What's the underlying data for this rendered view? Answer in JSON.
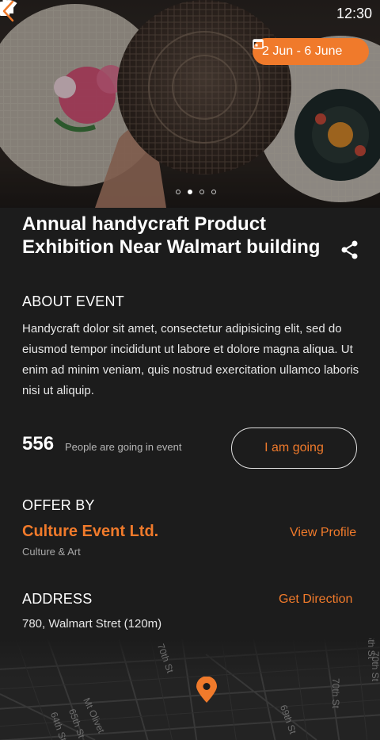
{
  "status_bar": {
    "time": "12:30",
    "icons": [
      "wifi-icon",
      "signal-icon",
      "battery-icon"
    ]
  },
  "hero": {
    "date_range": "2 Jun - 6 June",
    "carousel": {
      "total": 4,
      "active_index": 1
    }
  },
  "event": {
    "title": "Annual handycraft Product Exhibition Near Walmart building"
  },
  "about": {
    "heading": "ABOUT EVENT",
    "text": "Handycraft dolor sit amet, consectetur adipisicing elit, sed do eiusmod tempor incididunt ut labore et dolore magna aliqua. Ut enim ad minim veniam, quis nostrud exercitation ullamco laboris nisi ut aliquip."
  },
  "attendance": {
    "count": "556",
    "label": "People are going in event",
    "button_label": "I am going"
  },
  "offer": {
    "heading": "OFFER BY",
    "organizer_name": "Culture Event Ltd.",
    "category": "Culture & Art",
    "view_profile_label": "View Profile"
  },
  "address": {
    "heading": "ADDRESS",
    "text": "780, Walmart Stret (120m)",
    "get_direction_label": "Get Direction"
  },
  "map": {
    "streets": [
      "70th St",
      "70th St",
      "69th St",
      "Mt Olivet",
      "65th St",
      "64th St",
      "70th St",
      "76th St"
    ]
  },
  "colors": {
    "accent": "#f07a2b",
    "background": "#1c1c1c",
    "text": "#ffffff",
    "muted": "#a8a8a8"
  }
}
